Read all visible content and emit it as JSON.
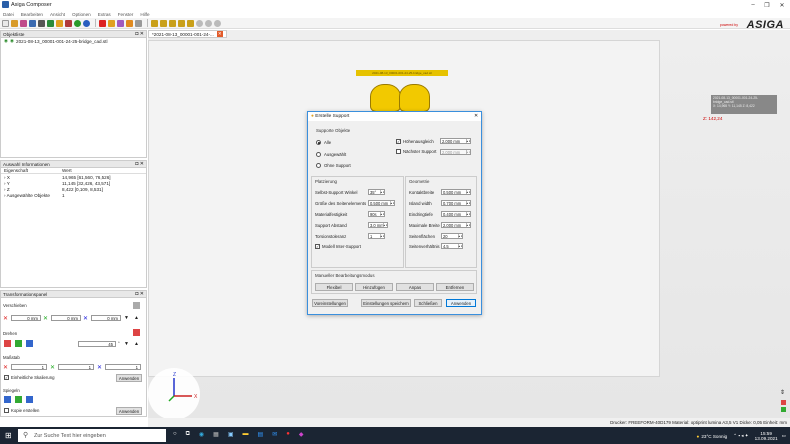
{
  "window": {
    "title": "Asiga Composer"
  },
  "menu": [
    "Datei",
    "Bearbeiten",
    "Ansicht",
    "Optionen",
    "Extras",
    "Fenster",
    "Hilfe"
  ],
  "brand": {
    "name": "ASIGA",
    "powered": "powered by"
  },
  "objects_panel": {
    "title": "Objektliste",
    "item": "2021-08-13_00001-001-24-25-bridge_cad.stl"
  },
  "selection_panel": {
    "title": "Auswahl Informationen",
    "col_property": "Eigenschaft",
    "col_value": "Wert",
    "rows": [
      {
        "name": "X",
        "value": "14,965 [61,560, 76,526]"
      },
      {
        "name": "Y",
        "value": "11,145 [32,426, 43,571]"
      },
      {
        "name": "Z",
        "value": "8,422 [0,109, 8,531]"
      },
      {
        "name": "Ausgewählte Objekte",
        "value": "1"
      }
    ]
  },
  "transform_panel": {
    "title": "Transformationspanel",
    "move_label": "Verschieben",
    "move_values": [
      "0 mm",
      "0 mm",
      "0 mm"
    ],
    "rotate_label": "Drehen",
    "rotate_value": "45",
    "rotate_unit": "°",
    "scale_label": "Maßstab",
    "scale_values": [
      "1",
      "1",
      "1"
    ],
    "uniform_label": "Einheitliche Skalierung",
    "apply_label": "Anwenden",
    "mirror_label": "Spiegeln",
    "copy_label": "Kopie erstellen",
    "apply2_label": "Anwenden"
  },
  "document_tab": {
    "label": "*2021-08-13_00001-001-24-..."
  },
  "viewport": {
    "model_label": "2021-08-13_00001-001-24-25-bridge_cad.stl",
    "info_lines": [
      "2021-08-13_00001-001-24-25-bridge_cad.stl",
      "X: 14,965  Y: 11,145  Z: 8,422"
    ],
    "red_value": "Z: 142,24"
  },
  "statusbar": {
    "text": "Drucker: FREEFORM-40D179  Material: optiprint lumina A3,5 V1  Dicke: 0,05  Einheit: mm"
  },
  "dialog": {
    "title": "Erstelle Support",
    "group_objects": "Supporte Objekte",
    "radio_all": "Alle",
    "radio_selected": "Ausgewählt",
    "radio_none": "Ohne Support",
    "height_label": "Höhenausgleich",
    "height_value": "2,000 mm",
    "next_label": "Nächster Support",
    "next_value": "2,000 mm",
    "group_placement": "Platzierung",
    "placement": [
      {
        "label": "Selbst-Support Winkel",
        "value": "35°"
      },
      {
        "label": "Größe des Seitenelements",
        "value": "0,500 mm"
      },
      {
        "label": "Materialfestigkeit",
        "value": "90s"
      },
      {
        "label": "Support Abstand",
        "value": "3,0 mm"
      },
      {
        "label": "Torsionstoleranz",
        "value": "1"
      }
    ],
    "model_inter_label": "Modell Inter-Support",
    "group_geometry": "Geometrie",
    "geometry": [
      {
        "label": "Kontaktbreite",
        "value": "0,500 mm"
      },
      {
        "label": "Island width",
        "value": "0,700 mm"
      },
      {
        "label": "Eindringtiefe",
        "value": "0,400 mm"
      },
      {
        "label": "Maximale Breite",
        "value": "2,000 mm"
      },
      {
        "label": "Seitenflächen",
        "value": "20"
      },
      {
        "label": "Seitenverhältnis",
        "value": "4,5"
      }
    ],
    "group_manual": "Manueller Bearbeitungsmodus",
    "manual_buttons": [
      "Flexibel",
      "Hinzufügen",
      "Anpas",
      "Entfernen"
    ],
    "bottom_buttons": [
      "Voreinstellungen",
      "Einstellungen speichern",
      "Schließen",
      "Anwenden"
    ]
  },
  "taskbar": {
    "search_placeholder": "Zur Suche Text hier eingeben",
    "weather": "23°C  Sonnig",
    "time": "15:59",
    "date": "13.09.2021"
  }
}
